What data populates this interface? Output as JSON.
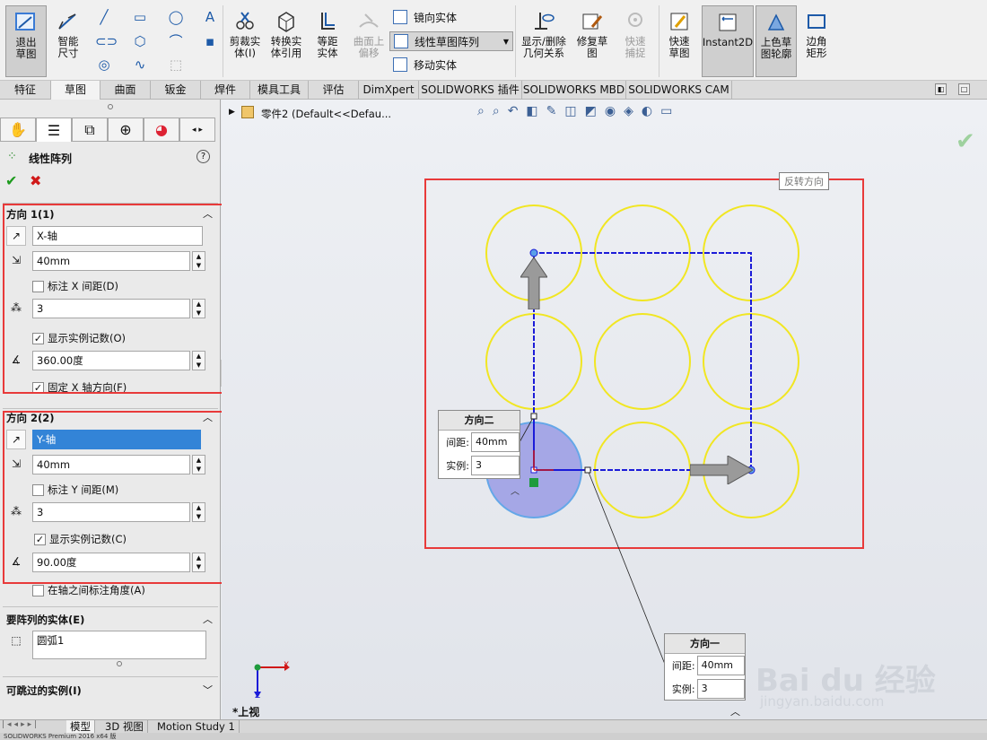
{
  "ribbon": {
    "exit_sketch": "退出草图",
    "smart_dim": "智能尺寸",
    "trim": "剪裁实体(I)",
    "convert": "转换实体引用",
    "offset": "等距实体",
    "surface_offset": "曲面上偏移",
    "mirror": "镜向实体",
    "linear_pattern": "线性草图阵列",
    "move": "移动实体",
    "show_delete": "显示/删除几何关系",
    "repair": "修复草图",
    "quick_snap": "快速捕捉",
    "rapid_sketch": "快速草图",
    "instant2d": "Instant2D",
    "shaded": "上色草图轮廓",
    "corner_rect": "边角矩形"
  },
  "tabs": [
    "特征",
    "草图",
    "曲面",
    "钣金",
    "焊件",
    "模具工具",
    "评估",
    "DimXpert",
    "SOLIDWORKS 插件",
    "SOLIDWORKS MBD",
    "SOLIDWORKS CAM"
  ],
  "panel": {
    "title": "线性阵列",
    "help": "?",
    "dir1": {
      "header": "方向 1(1)",
      "axis": "X-轴",
      "spacing": "40mm",
      "dim_label": "标注 X 间距(D)",
      "count": "3",
      "show_count": "显示实例记数(O)",
      "angle": "360.00度",
      "fix_axis": "固定 X 轴方向(F)"
    },
    "dir2": {
      "header": "方向 2(2)",
      "axis": "Y-轴",
      "spacing": "40mm",
      "dim_label": "标注 Y 间距(M)",
      "count": "3",
      "show_count": "显示实例记数(C)",
      "angle": "90.00度",
      "dim_angle": "在轴之间标注角度(A)"
    },
    "entities": {
      "header": "要阵列的实体(E)",
      "value": "圆弧1"
    },
    "skip": {
      "header": "可跳过的实例(I)"
    }
  },
  "canvas": {
    "breadcrumb": "零件2  (Default<<Defau...",
    "tooltip": "反转方向",
    "dir2_box": {
      "title": "方向二",
      "spacing_label": "间距:",
      "spacing": "40mm",
      "count_label": "实例:",
      "count": "3"
    },
    "dir1_box": {
      "title": "方向一",
      "spacing_label": "间距:",
      "spacing": "40mm",
      "count_label": "实例:",
      "count": "3"
    },
    "view_label": "*上视",
    "triad_x": "X",
    "triad_z": "Z"
  },
  "bottom_tabs": [
    "模型",
    "3D 视图",
    "Motion Study 1"
  ],
  "status_text": "SOLIDWORKS Premium 2016 x64 版",
  "watermark": {
    "brand": "Bai du 经验",
    "url": "jingyan.baidu.com"
  },
  "colors": {
    "accent_red": "#e83a3a",
    "circle_yellow": "#f1e622",
    "sketch_blue": "#1b1bd8",
    "selected_fill": "#a5a7e6"
  }
}
